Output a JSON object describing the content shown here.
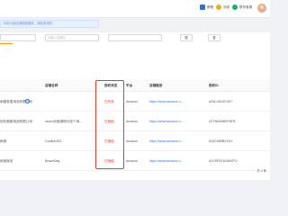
{
  "header": {
    "actions": [
      {
        "label": "教程",
        "icon": "book-icon",
        "color": "#2f6fde"
      },
      {
        "label": "消息",
        "icon": "bell-icon",
        "color": "#f5a623"
      },
      {
        "label": "联系客服",
        "icon": "headset-icon",
        "color": "#17b26a"
      }
    ]
  },
  "notice": {
    "text": "向亚马逊店铺授权服务，授权前请先..."
  },
  "brand": {
    "name": "amazon",
    "accent": "#ff9900"
  },
  "filters": {
    "store_placeholder": "请输入店铺名",
    "search_label": "搜",
    "reset_label": "重"
  },
  "table": {
    "columns": [
      "店铺名称",
      "授权状态",
      "平台",
      "店铺链接",
      "授权ID"
    ],
    "rows": [
      {
        "company": "雨春惠童用品有限公司",
        "store": "",
        "status": "已失效",
        "platform": "Amazon",
        "link": "https://www.amazon.c...",
        "auth_id": "A33C40UD7407"
      },
      {
        "company": "优旺美颜用品有限公司",
        "store": "sirsen光面调研分变个体...",
        "status": "已授权",
        "platform": "Amazon",
        "link": "https://www.amazon.c...",
        "auth_id": "A2TNWMBVP6FR"
      },
      {
        "company": "雨惠",
        "store": "Coolfull-BO",
        "status": "已授权",
        "platform": "Amazon",
        "link": "https://www.amazon.c...",
        "auth_id": "A10CWBBV1DV"
      },
      {
        "company": "雨惠商务",
        "store": "BraveWay",
        "status": "已授权",
        "platform": "Amazon",
        "link": "https://www.amazon.c...",
        "auth_id": "A1V9FSVUSWVFO"
      }
    ]
  },
  "footer": {
    "total": "共 4 条"
  },
  "colors": {
    "link": "#2f6fde",
    "status_red": "#e0312a",
    "highlight": "#e53935"
  }
}
